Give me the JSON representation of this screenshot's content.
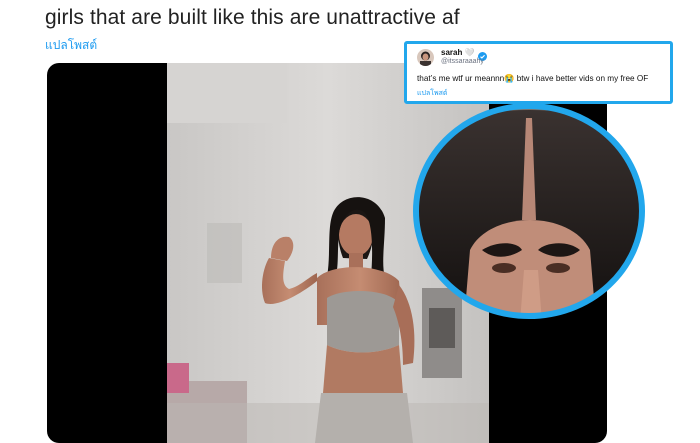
{
  "tweet": {
    "text": "girls that are built like this are unattractive af",
    "translate_label": "แปลโพสต์"
  },
  "media": {
    "kind": "video"
  },
  "quote_reply": {
    "display_name": "sarah",
    "name_suffix_emoji": "🤍",
    "handle": "@itssaraaahy",
    "text": "that’s me wtf ur meannn",
    "emoji": "😭",
    "text_after_emoji": " btw i have better vids on my free OF",
    "translate_label": "แปลโพสต์",
    "verified": true
  },
  "colors": {
    "accent_blue": "#22a7ec",
    "link_blue": "#1d9bf0",
    "text_dark": "#222222",
    "media_bg": "#000000"
  },
  "icons": [
    "verified-badge-icon",
    "avatar"
  ]
}
